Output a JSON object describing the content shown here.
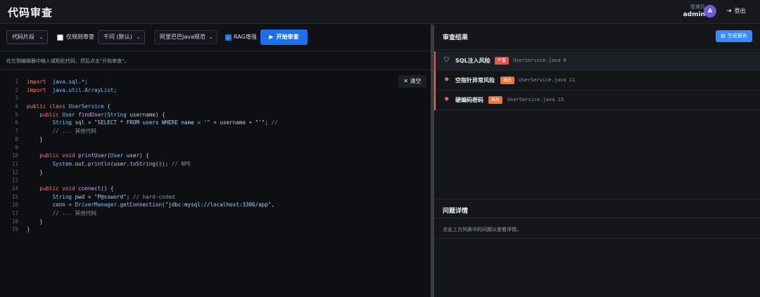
{
  "header": {
    "title": "代码审查",
    "user_role": "管理员",
    "user_name": "admin",
    "avatar_letter": "A",
    "logout_label": "登出",
    "logout_icon": "logout-icon"
  },
  "toolbar": {
    "mode_select": "代码片段",
    "rules_only_label": "仅规则审查",
    "rules_only_checked": false,
    "model_select": "千问 (默认)",
    "ruleset_select": "阿里巴巴Java规范",
    "rag_label": "RAG增强",
    "rag_checked": true,
    "start_label": "开始审查"
  },
  "editor": {
    "hint": "在左侧编辑器中输入或粘贴代码，然后点击\"开始审查\"。",
    "clear_label": "清空",
    "lines": [
      {
        "n": "1",
        "segs": [
          [
            "kw",
            "import"
          ],
          [
            "",
            "  "
          ],
          [
            "ty",
            "java.sql.*"
          ],
          [
            "",
            ";"
          ]
        ]
      },
      {
        "n": "2",
        "segs": [
          [
            "kw",
            "import"
          ],
          [
            "",
            "  "
          ],
          [
            "ty",
            "java.util.ArrayList"
          ],
          [
            "",
            ";"
          ]
        ]
      },
      {
        "n": "3",
        "segs": [
          [
            "",
            ""
          ]
        ]
      },
      {
        "n": "4",
        "segs": [
          [
            "kw",
            "public class"
          ],
          [
            "",
            " "
          ],
          [
            "ty",
            "UserService"
          ],
          [
            "",
            " {"
          ]
        ]
      },
      {
        "n": "5",
        "segs": [
          [
            "",
            "    "
          ],
          [
            "kw",
            "public"
          ],
          [
            "",
            " "
          ],
          [
            "ty",
            "User"
          ],
          [
            "",
            " "
          ],
          [
            "fn",
            "findUser"
          ],
          [
            "",
            "("
          ],
          [
            "ty",
            "String"
          ],
          [
            "",
            " username) {"
          ]
        ]
      },
      {
        "n": "6",
        "segs": [
          [
            "",
            "        "
          ],
          [
            "ty",
            "String"
          ],
          [
            "",
            " sql = "
          ],
          [
            "st",
            "\"SELECT * FROM users WHERE name = '\""
          ],
          [
            "",
            " + username + "
          ],
          [
            "st",
            "\"'\""
          ],
          [
            "",
            "; "
          ],
          [
            "cm",
            "//"
          ]
        ]
      },
      {
        "n": "7",
        "segs": [
          [
            "",
            "        "
          ],
          [
            "cm",
            "// ... 其他代码"
          ]
        ]
      },
      {
        "n": "8",
        "segs": [
          [
            "",
            "    }"
          ]
        ]
      },
      {
        "n": "9",
        "segs": [
          [
            "",
            ""
          ]
        ]
      },
      {
        "n": "10",
        "segs": [
          [
            "",
            "    "
          ],
          [
            "kw",
            "public void"
          ],
          [
            "",
            " "
          ],
          [
            "fn",
            "printUser"
          ],
          [
            "",
            "("
          ],
          [
            "ty",
            "User"
          ],
          [
            "",
            " user) {"
          ]
        ]
      },
      {
        "n": "11",
        "segs": [
          [
            "",
            "        "
          ],
          [
            "ty",
            "System"
          ],
          [
            "",
            ".out."
          ],
          [
            "fn",
            "println"
          ],
          [
            "",
            "(user."
          ],
          [
            "fn",
            "toString"
          ],
          [
            "",
            "()); "
          ],
          [
            "cm",
            "// NPE"
          ]
        ]
      },
      {
        "n": "12",
        "segs": [
          [
            "",
            "    }"
          ]
        ]
      },
      {
        "n": "13",
        "segs": [
          [
            "",
            ""
          ]
        ]
      },
      {
        "n": "14",
        "segs": [
          [
            "",
            "    "
          ],
          [
            "kw",
            "public void"
          ],
          [
            "",
            " "
          ],
          [
            "fn",
            "connect"
          ],
          [
            "",
            "() {"
          ]
        ]
      },
      {
        "n": "15",
        "segs": [
          [
            "",
            "        "
          ],
          [
            "ty",
            "String"
          ],
          [
            "",
            " pwd = "
          ],
          [
            "st",
            "\"P@ssword\""
          ],
          [
            "",
            "; "
          ],
          [
            "cm",
            "// hard-coded"
          ]
        ]
      },
      {
        "n": "16",
        "segs": [
          [
            "",
            "        conn = "
          ],
          [
            "ty",
            "DriverManager"
          ],
          [
            "",
            "."
          ],
          [
            "fn",
            "getConnection"
          ],
          [
            "",
            "("
          ],
          [
            "st",
            "\"jdbc:mysql://localhost:3306/app\""
          ],
          [
            "",
            ","
          ]
        ]
      },
      {
        "n": "17",
        "segs": [
          [
            "",
            "        "
          ],
          [
            "cm",
            "// ... 其他代码"
          ]
        ]
      },
      {
        "n": "18",
        "segs": [
          [
            "",
            "    }"
          ]
        ]
      },
      {
        "n": "19",
        "segs": [
          [
            "",
            "}"
          ]
        ]
      }
    ]
  },
  "results": {
    "title": "审查结果",
    "report_label": "生成报告",
    "issues": [
      {
        "name": "SQL注入风险",
        "severity": "严重",
        "file": "UserService.java",
        "line": "6",
        "color": "#e5534b",
        "icon": "shield-warning-icon"
      },
      {
        "name": "空指针异常风险",
        "severity": "高危",
        "file": "UserService.java",
        "line": "11",
        "color": "#e8743b",
        "icon": "bug-icon"
      },
      {
        "name": "硬编码密码",
        "severity": "高危",
        "file": "UserService.java",
        "line": "15",
        "color": "#e8743b",
        "icon": "bug-icon"
      }
    ]
  },
  "detail": {
    "title": "问题详情",
    "placeholder": "点击上方列表中的问题以查看详情。"
  },
  "colors": {
    "accent": "#1f6feb",
    "critical": "#e5534b",
    "high": "#e8743b"
  }
}
